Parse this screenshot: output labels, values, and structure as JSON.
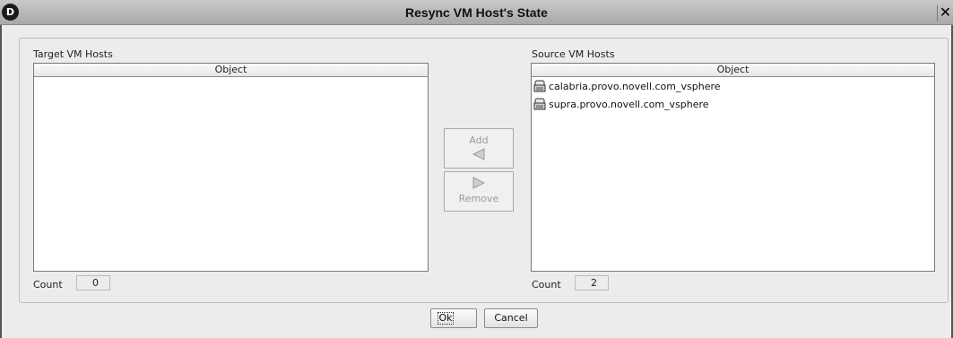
{
  "window": {
    "title": "Resync VM Host's State",
    "app_icon_letter": "D",
    "close_glyph": "✕"
  },
  "target": {
    "label": "Target VM Hosts",
    "column_header": "Object",
    "items": [],
    "count_label": "Count",
    "count_value": "0"
  },
  "source": {
    "label": "Source VM Hosts",
    "column_header": "Object",
    "items": [
      {
        "name": "calabria.provo.novell.com_vsphere",
        "icon": "vm-host-icon"
      },
      {
        "name": "supra.provo.novell.com_vsphere",
        "icon": "vm-host-icon"
      }
    ],
    "count_label": "Count",
    "count_value": "2"
  },
  "transfer": {
    "add_label": "Add",
    "remove_label": "Remove"
  },
  "footer": {
    "ok_label": "Ok",
    "cancel_label": "Cancel"
  }
}
